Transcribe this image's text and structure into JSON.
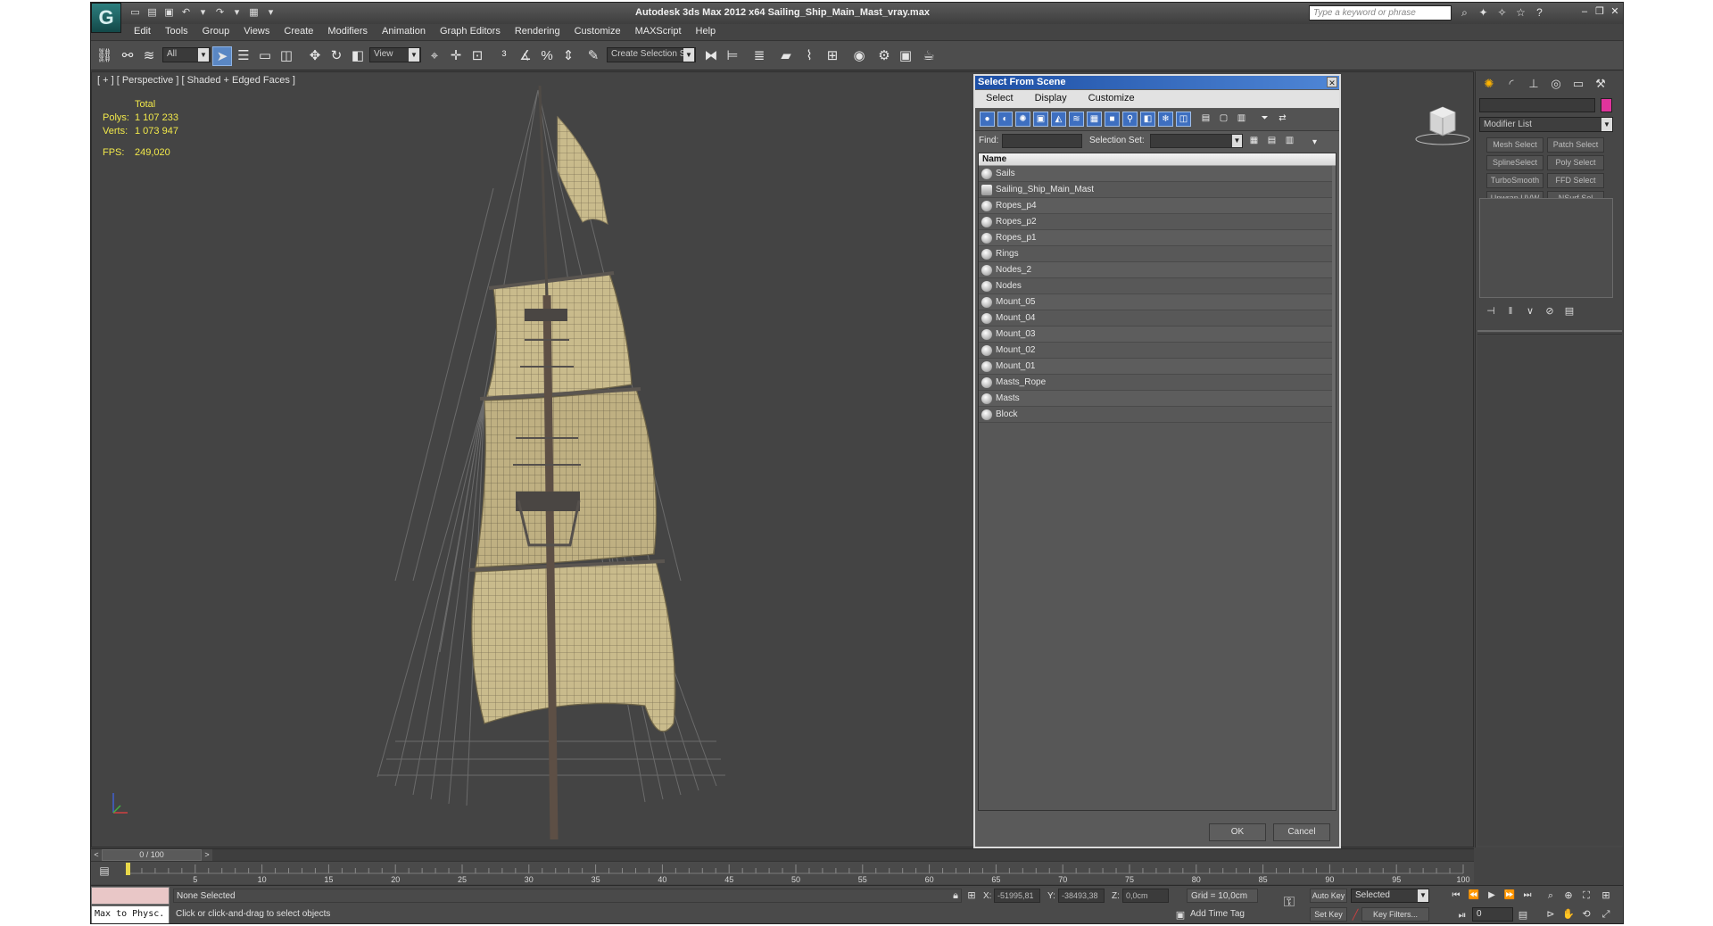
{
  "window": {
    "title": "Autodesk 3ds Max  2012 x64    Sailing_Ship_Main_Mast_vray.max",
    "search_placeholder": "Type a keyword or phrase"
  },
  "menu": [
    "Edit",
    "Tools",
    "Group",
    "Views",
    "Create",
    "Modifiers",
    "Animation",
    "Graph Editors",
    "Rendering",
    "Customize",
    "MAXScript",
    "Help"
  ],
  "toolbar": {
    "selection_filter": "All",
    "ref_coord": "View",
    "named_selection": "Create Selection Se"
  },
  "viewport": {
    "label": "[ + ] [ Perspective ] [ Shaded + Edged Faces ]",
    "stats_header": "Total",
    "polys_label": "Polys:",
    "polys_value": "1 107 233",
    "verts_label": "Verts:",
    "verts_value": "1 073 947",
    "fps_label": "FPS:",
    "fps_value": "249,020"
  },
  "dialog": {
    "title": "Select From Scene",
    "menus": [
      "Select",
      "Display",
      "Customize"
    ],
    "find_label": "Find:",
    "find_value": "",
    "selection_set_label": "Selection Set:",
    "selection_set_value": "",
    "column_header": "Name",
    "items": [
      "Sails",
      "Sailing_Ship_Main_Mast",
      "Ropes_p4",
      "Ropes_p2",
      "Ropes_p1",
      "Rings",
      "Nodes_2",
      "Nodes",
      "Mount_05",
      "Mount_04",
      "Mount_03",
      "Mount_02",
      "Mount_01",
      "Masts_Rope",
      "Masts",
      "Block"
    ],
    "ok_label": "OK",
    "cancel_label": "Cancel"
  },
  "command_panel": {
    "modifier_list": "Modifier List",
    "buttons": [
      "Mesh Select",
      "Patch Select",
      "SplineSelect",
      "Poly Select",
      "TurboSmooth",
      "FFD Select",
      "Unwrap UVW",
      "NSurf Sel"
    ],
    "object_color": "#e0349c"
  },
  "timeline": {
    "slider_label": "0 / 100",
    "ticks": [
      5,
      10,
      15,
      20,
      25,
      30,
      35,
      40,
      45,
      50,
      55,
      60,
      65,
      70,
      75,
      80,
      85,
      90,
      95,
      100
    ]
  },
  "status": {
    "maxscript": "Max to Physc.",
    "selection": "None Selected",
    "prompt": "Click or click-and-drag to select objects",
    "x_label": "X:",
    "x_value": "-51995,81",
    "y_label": "Y:",
    "y_value": "-38493,38",
    "z_label": "Z:",
    "z_value": "0,0cm",
    "grid": "Grid = 10,0cm",
    "add_time_tag": "Add Time Tag",
    "auto_key": "Auto Key",
    "set_key": "Set Key",
    "selected_dropdown": "Selected",
    "key_filters": "Key Filters...",
    "current_frame": "0"
  },
  "colors": {
    "stats_yellow": "#f2e94a",
    "dialog_title_blue": "#1d4fa5",
    "viewport_bg": "#444444",
    "sail": "#c8b98a"
  },
  "icons": {
    "app_logo": "3ds-max-logo-icon",
    "select_object": "select-arrow-icon",
    "move": "move-icon",
    "rotate": "rotate-icon",
    "scale": "scale-icon",
    "render": "teapot-render-icon"
  }
}
